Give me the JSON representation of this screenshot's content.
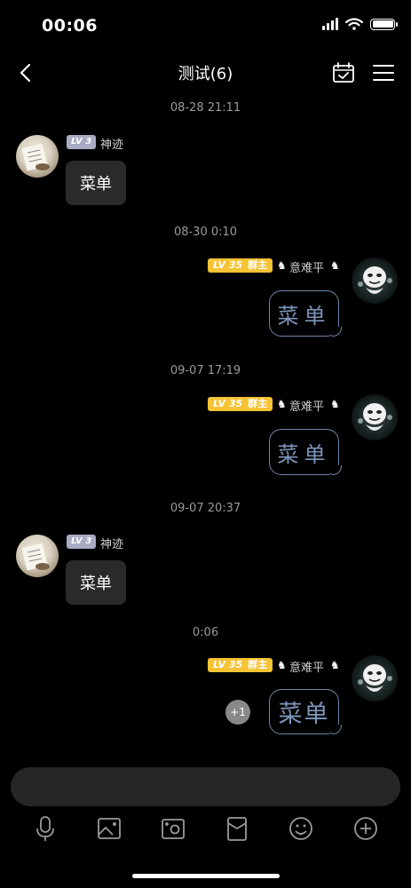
{
  "status_bar": {
    "time": "00:06"
  },
  "nav": {
    "title": "测试(6)"
  },
  "messages": [
    {
      "timestamp": "08-28 21:11",
      "side": "left",
      "level": "LV 3",
      "name": "神迹",
      "text": "菜单"
    },
    {
      "timestamp": "08-30 0:10",
      "side": "right",
      "level": "LV 35",
      "role": "群主",
      "name": "意难平",
      "text": "菜单"
    },
    {
      "timestamp": "09-07 17:19",
      "side": "right",
      "level": "LV 35",
      "role": "群主",
      "name": "意难平",
      "text": "菜单"
    },
    {
      "timestamp": "09-07 20:37",
      "side": "left",
      "level": "LV 3",
      "name": "神迹",
      "text": "菜单"
    },
    {
      "timestamp": "0:06",
      "side": "right",
      "level": "LV 35",
      "role": "群主",
      "name": "意难平",
      "text": "菜单",
      "reaction_count": "+1"
    }
  ],
  "toolbar": {
    "icons": [
      "microphone-icon",
      "image-icon",
      "camera-icon",
      "red-packet-icon",
      "emoji-icon",
      "plus-icon"
    ]
  },
  "colors": {
    "background": "#000000",
    "level_gold": "#f6c334",
    "level_gray": "#a8abc3",
    "bubble_left": "#2a2a2a",
    "bubble_right_border": "#6d86a8"
  }
}
